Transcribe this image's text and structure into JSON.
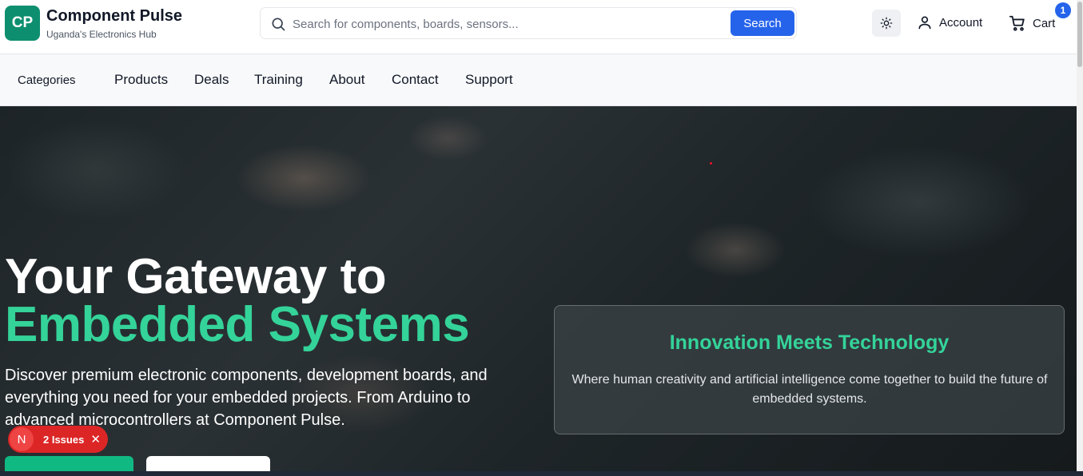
{
  "header": {
    "logo_text": "CP",
    "brand_name": "Component Pulse",
    "tagline": "Uganda's Electronics Hub",
    "search_placeholder": "Search for components, boards, sensors...",
    "search_button": "Search",
    "account_label": "Account",
    "cart_label": "Cart",
    "cart_count": "1"
  },
  "nav": {
    "categories_label": "Categories",
    "items": [
      "Products",
      "Deals",
      "Training",
      "About",
      "Contact",
      "Support"
    ]
  },
  "hero": {
    "title_line1": "Your Gateway to",
    "title_line2": "Embedded Systems",
    "description": "Discover premium electronic components, development boards, and everything you need for your embedded projects. From Arduino to advanced microcontrollers at Component Pulse."
  },
  "innovation": {
    "title": "Innovation Meets Technology",
    "text": "Where human creativity and artificial intelligence come together to build the future of embedded systems."
  },
  "issues_badge": {
    "logo": "N",
    "label": "2 Issues",
    "close": "✕"
  },
  "colors": {
    "brand": "#0d8f6f",
    "accent_blue": "#2563eb",
    "accent_green": "#34d399",
    "issues_red": "#dc2626"
  }
}
